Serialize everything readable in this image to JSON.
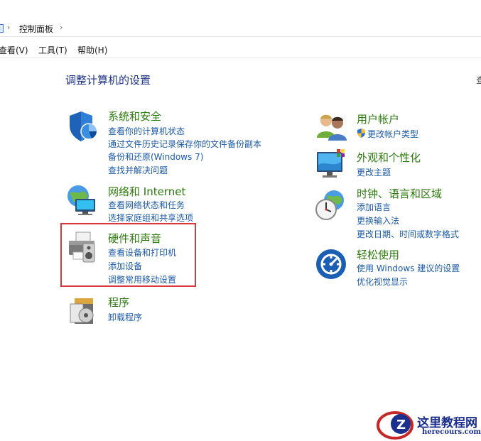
{
  "breadcrumb": {
    "location": "控制面板"
  },
  "menu": {
    "view": "查看(V)",
    "tools": "工具(T)",
    "help": "帮助(H)"
  },
  "page": {
    "title": "调整计算机的设置",
    "right_edge": "查"
  },
  "categories": {
    "system_security": {
      "title": "系统和安全",
      "links": [
        "查看你的计算机状态",
        "通过文件历史记录保存你的文件备份副本",
        "备份和还原(Windows 7)",
        "查找并解决问题"
      ]
    },
    "network": {
      "title": "网络和 Internet",
      "links": [
        "查看网络状态和任务",
        "选择家庭组和共享选项"
      ]
    },
    "hardware_sound": {
      "title": "硬件和声音",
      "links": [
        "查看设备和打印机",
        "添加设备",
        "调整常用移动设置"
      ]
    },
    "programs": {
      "title": "程序",
      "links": [
        "卸载程序"
      ]
    },
    "user_accounts": {
      "title": "用户帐户",
      "links": [
        "更改帐户类型"
      ]
    },
    "appearance": {
      "title": "外观和个性化",
      "links": [
        "更改主题"
      ]
    },
    "clock_region": {
      "title": "时钟、语言和区域",
      "links": [
        "添加语言",
        "更换输入法",
        "更改日期、时间或数字格式"
      ]
    },
    "ease_access": {
      "title": "轻松使用",
      "links": [
        "使用 Windows 建议的设置",
        "优化视觉显示"
      ]
    }
  },
  "watermark": {
    "cn": "这里教程网",
    "en": "herecours.com"
  },
  "colors": {
    "title": "#1e3287",
    "category": "#2b7a0b",
    "link": "#1b5aa8",
    "highlight": "#d9363e"
  }
}
